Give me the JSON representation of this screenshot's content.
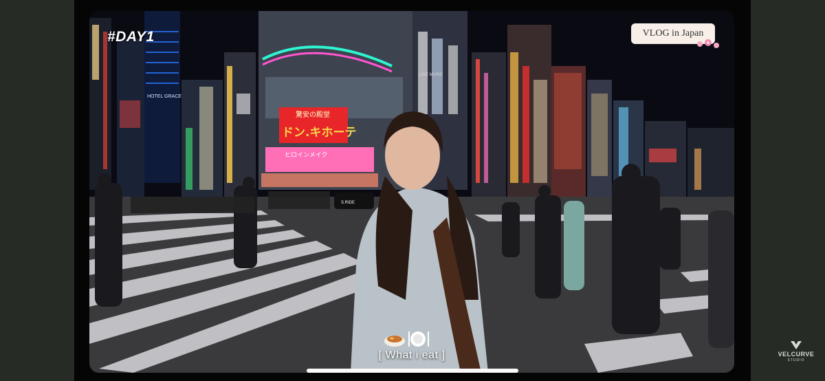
{
  "overlay": {
    "day_tag": "#DAY1",
    "vlog_badge": "VLOG in Japan",
    "caption_text": "[  What i eat  ]"
  },
  "scene_signs": {
    "hotel": "HOTEL GRACERY",
    "donki_top": "驚安の殿堂",
    "donki_main": "ドン.キホーテ",
    "donki_sub": "ヒロインメイク",
    "taxi": "S.RIDE",
    "live": "LIVE MUSIC"
  },
  "watermark": {
    "brand": "VELCURVE",
    "sub": "STUDIO"
  },
  "colors": {
    "sidebar": "#262c25",
    "badge_bg": "#f7efe8",
    "neon_red": "#e8262a",
    "neon_yellow": "#f6d64a",
    "neon_pink": "#ff5fb8",
    "home_indicator": "#fafafa"
  },
  "icons": {
    "caption_left": "food-bowl-icon",
    "caption_right": "plate-cutlery-icon",
    "badge_deco": "cherry-blossom-icon",
    "watermark": "velcurve-logo-icon"
  }
}
